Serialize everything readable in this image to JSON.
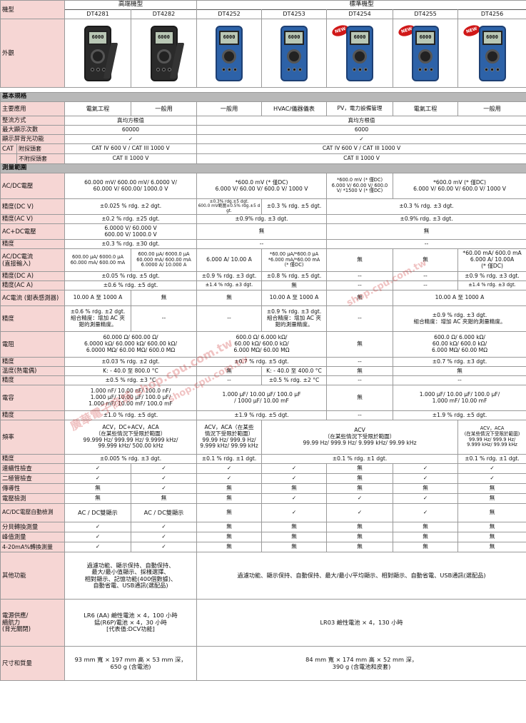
{
  "header": {
    "label": "機型",
    "group_high": "高端機型",
    "group_std": "標準機型",
    "models": [
      "DT4281",
      "DT4282",
      "DT4252",
      "DT4253",
      "DT4254",
      "DT4255",
      "DT4256"
    ]
  },
  "appearance": {
    "label": "外觀",
    "lcd_text": "6000",
    "new_badge": "NEW"
  },
  "sec_basic": "基本規格",
  "app": {
    "label": "主要應用",
    "v": [
      "電氣工程",
      "一般用",
      "一般用",
      "HVAC/儀器儀表",
      "PV，電力設備管理",
      "電氣工程",
      "一般用"
    ]
  },
  "rect": {
    "label": "整流方式",
    "a": "真均方根值",
    "b": "真均方根值"
  },
  "maxd": {
    "label": "最大顯示次數",
    "a": "60000",
    "b": "6000"
  },
  "backl": {
    "label": "顯示屏背光功能",
    "a": "✓",
    "b": "✓"
  },
  "cat": {
    "label": "CAT",
    "sub1": "附探頭套",
    "sub2": "不附探頭套",
    "a1": "CAT IV 600 V / CAT III 1000 V",
    "b1": "CAT IV 600 V / CAT III 1000 V",
    "a2": "CAT II 1000 V",
    "b2": "CAT II 1000 V"
  },
  "sec_meas": "測量範圍",
  "acdcv": {
    "label": "AC/DC電壓",
    "a": "60.000 mV/ 600.00 mV/ 6.0000 V/\n60.000 V/ 600.00/ 1000.0 V",
    "b": "*600.0 mV (* 僅DC)\n6.000 V/ 60.00 V/ 600.0 V/ 1000 V",
    "c": "*600.0 mV (* 僅DC)\n6.000 V/ 60.00 V/ 600.0\nV/ *1500 V (* 僅DC)",
    "d": "*600.0 mV (* 僅DC)\n6.000 V/ 60.00 V/ 600.0 V/ 1000 V"
  },
  "accdcv": {
    "label": "精度(DC V)",
    "a": "±0.025 % rdg. ±2 dgt.",
    "b": "±0.3% rdg.±5 dgt.\n600.0 mV範圍±0.5% rdg.±5 dgt.",
    "c": "±0.3 % rdg. ±5 dgt.",
    "d": "±0.3 % rdg. ±3 dgt."
  },
  "accacv": {
    "label": "精度(AC V)",
    "a": "±0.2 % rdg. ±25 dgt.",
    "b": "±0.9% rdg. ±3 dgt.",
    "c": "±0.9% rdg. ±3 dgt."
  },
  "acpdc": {
    "label": "AC+DC電壓",
    "a": "6.0000 V/ 60.000 V\n600.00 V/ 1000.0 V",
    "b": "無",
    "c": "無"
  },
  "acpdc_acc": {
    "label": "精度",
    "a": "±0.3 % rdg. ±30 dgt.",
    "b": "--",
    "c": "--"
  },
  "acdci": {
    "label": "AC/DC電流\n(直接輸入)",
    "a": "600.00 μA/ 6000.0 μA\n60.000 mA/ 600.00 mA",
    "b": "600.00 μA/ 6000.0 μA\n60.000 mA/ 600.00 mA\n6.0000 A/ 10.000 A",
    "c": "6.000 A/ 10.00 A",
    "d": "*60.00 μA/*600.0 μA\n*6.000 mA/*60.00 mA\n(* 僅DC)",
    "e": "無",
    "f": "無",
    "g": "*60.00 mA/ 600.0 mA\n6.000 A/ 10.00A\n(* 僅DC)"
  },
  "accdca": {
    "label": "精度(DC A)",
    "a": "±0.05 % rdg. ±5 dgt.",
    "c": "±0.9 % rdg. ±3 dgt.",
    "d": "±0.8 % rdg. ±5 dgt.",
    "e": "--",
    "f": "--",
    "g": "±0.9 % rdg. ±3 dgt."
  },
  "accaca": {
    "label": "精度(AC A)",
    "a": "±0.6 % rdg. ±5 dgt.",
    "c": "±1.4 % rdg. ±3 dgt.",
    "d": "無",
    "e": "--",
    "f": "--",
    "g": "±1.4 % rdg. ±3 dgt."
  },
  "clamp": {
    "label": "AC電流 (鉗表感測器)",
    "a": "10.00 A 至 1000 A",
    "b": "無",
    "c": "無",
    "d": "10.00 A 至 1000 A",
    "e": "無",
    "f": "10.00 A 至 1000 A"
  },
  "clamp_acc": {
    "label": "精度",
    "a": "±0.6 % rdg. ±2 dgt.\n組合精度：增加 AC 夾\n鉗的測量精度。",
    "b": "--",
    "c": "--",
    "d": "±0.9 % rdg. ±3 dgt.\n組合精度：增加 AC 夾\n鉗的測量精度。",
    "e": "--",
    "f": "±0.9 % rdg. ±3 dgt.\n組合精度：增加 AC 夾鉗的測量精度。"
  },
  "res": {
    "label": "電阻",
    "a": "60.000 Ω/ 600.00 Ω/\n6.0000 kΩ/ 60.000 kΩ/ 600.00 kΩ/\n6.0000 MΩ/ 60.00 MΩ/ 600.0 MΩ",
    "b": "600.0 Ω/ 6.000 kΩ/\n60.00 kΩ/ 600.0 kΩ/\n6.000 MΩ/ 60.00 MΩ",
    "c": "無",
    "d": "600.0 Ω/ 6.000 kΩ/\n60.00 kΩ/ 600.0 kΩ/\n6.000 MΩ/ 60.00 MΩ"
  },
  "res_acc": {
    "label": "精度",
    "a": "±0.03 % rdg. ±2 dgt.",
    "b": "±0.7 % rdg. ±5 dgt.",
    "c": "--",
    "d": "±0.7 % rdg. ±3 dgt."
  },
  "temp": {
    "label": "溫度(熱電偶)",
    "a": "K: - 40.0 至 800.0 °C",
    "b": "無",
    "c": "K: - 40.0 至 400.0 °C",
    "d": "無",
    "e": "無"
  },
  "temp_acc": {
    "label": "精度",
    "a": "±0.5 % rdg. ±3 °C",
    "b": "--",
    "c": "±0.5 % rdg. ±2 °C",
    "d": "--",
    "e": "--"
  },
  "cap": {
    "label": "電容",
    "a": "1.000 nF/ 10.00 nF/ 100.0 nF/\n1.000 μF/ 10.00 μF/ 100.0 μF/\n1.000 mF/ 10.00 mF/ 100.0 mF",
    "b": "1.000 μF/ 10.00 μF/ 100.0 μF\n/ 1000 μF/ 10.00 mF",
    "c": "無",
    "d": "1.000 μF/ 10.00 μF/ 100.0 μF/\n1.000 mF/ 10.00 mF"
  },
  "cap_acc": {
    "label": "精度",
    "a": "±1.0 % rdg. ±5 dgt.",
    "b": "±1.9 % rdg. ±5 dgt.",
    "c": "--",
    "d": "±1.9 % rdg. ±5 dgt."
  },
  "freq": {
    "label": "頻率",
    "a": "ACV，DC+ACV，ACA\n（在某些情況下受限於範圍）\n99.999 Hz/ 999.99 Hz/ 9.9999 kHz/\n99.999 kHz/ 500.00 kHz",
    "b": "ACV，ACA（在某些\n情況下受限於範圍）\n99.99 Hz/ 999.9 Hz/\n9.999 kHz/ 99.99 kHz",
    "c": "ACV\n（在某些情況下受限於範圍）\n99.99 Hz/ 999.9 Hz/ 9.999 kHz/ 99.99 kHz",
    "d": "ACV，ACA\n(在某些情況下受限於範圍)\n99.99 Hz/ 999.9 Hz/\n9.999 kHz/ 99.99 kHz"
  },
  "freq_acc": {
    "label": "精度",
    "a": "±0.005 % rdg. ±3 dgt.",
    "b": "±0.1 % rdg. ±1 dgt.",
    "c": "±0.1 % rdg. ±1 dgt.",
    "d": "±0.1 % rdg. ±1 dgt."
  },
  "cont": {
    "label": "連續性檢查",
    "v": [
      "✓",
      "✓",
      "✓",
      "✓",
      "無",
      "✓",
      "✓"
    ]
  },
  "diode": {
    "label": "二極管檢查",
    "v": [
      "✓",
      "✓",
      "✓",
      "✓",
      "無",
      "✓",
      "✓"
    ]
  },
  "cond": {
    "label": "傳導性",
    "v": [
      "無",
      "✓",
      "無",
      "無",
      "無",
      "無",
      "無"
    ]
  },
  "vdet": {
    "label": "電壓檢測",
    "v": [
      "無",
      "無",
      "無",
      "✓",
      "✓",
      "✓",
      "無"
    ]
  },
  "auto": {
    "label": "AC/DC電壓自動檢測",
    "v": [
      "AC / DC雙顯示",
      "AC / DC雙顯示",
      "無",
      "✓",
      "✓",
      "✓",
      "無"
    ]
  },
  "pct": {
    "label": "分貝轉換測量",
    "v": [
      "✓",
      "✓",
      "無",
      "無",
      "無",
      "無",
      "無"
    ]
  },
  "peak": {
    "label": "峰值測量",
    "v": [
      "✓",
      "✓",
      "無",
      "無",
      "無",
      "無",
      "無"
    ]
  },
  "ma": {
    "label": "4-20mA%轉換測量",
    "v": [
      "✓",
      "✓",
      "無",
      "無",
      "無",
      "無",
      "無"
    ]
  },
  "other": {
    "label": "其他功能",
    "a": "過濾功能、顯示保持、自動保持、\n最大/最小值顯示、採樣選擇、\n相對顯示、記憶功能(400個數據)、\n自動省電、USB通訊(選配品)",
    "b": "過濾功能、顯示保持、自動保持、最大/最小/平均顯示、相對顯示、自動省電、USB通訊(選配品)"
  },
  "power": {
    "label": "電源供應/\n續航力\n(背光關閉)",
    "a": "LR6 (AA) 鹼性電池 × 4，100 小時\n錳(R6P)電池 × 4，30 小時\n[代表值:DCV功能]",
    "b": "LR03 鹼性電池 × 4，130 小時"
  },
  "dims": {
    "label": "尺寸和質量",
    "a": "93 mm 寬 × 197 mm 高 × 53 mm 深，\n650 g (含電池)",
    "b": "84 mm 寬 × 174 mm 高 × 52 mm 深，\n390 g (含電池和皮套)"
  },
  "watermark": {
    "t1": "廣華電子商城 shop.cpu.com.tw",
    "t2": "shop.cpu.com.tw",
    "t3": "shop.cpu.com.tw"
  },
  "colors": {
    "label_bg": "#f6d6d4",
    "section_bg": "#b8b8b8",
    "meter_blue": "#2d62a8",
    "meter_black": "#2a2a2a",
    "badge_red": "#d01818"
  }
}
